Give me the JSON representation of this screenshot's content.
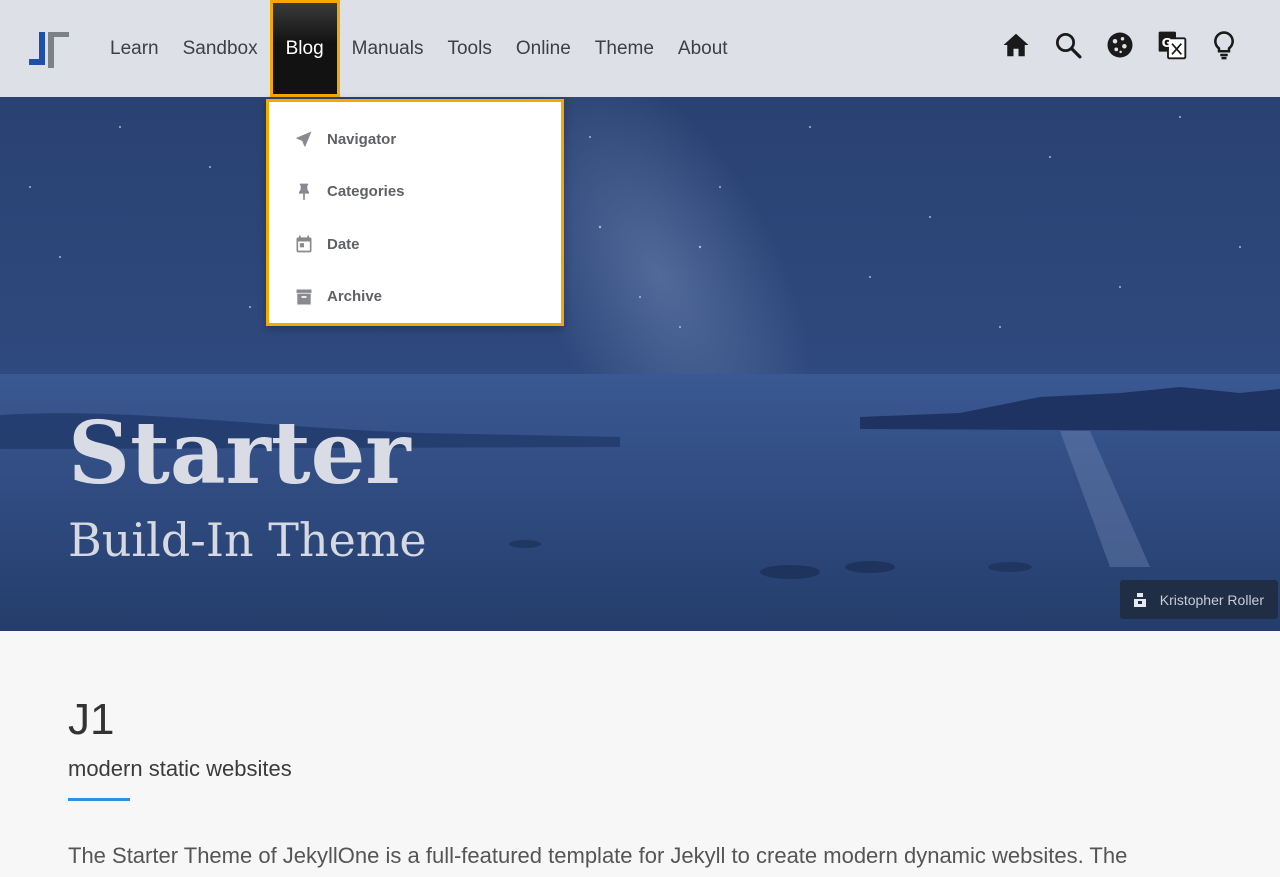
{
  "nav": {
    "items": [
      {
        "label": "Learn"
      },
      {
        "label": "Sandbox"
      },
      {
        "label": "Blog"
      },
      {
        "label": "Manuals"
      },
      {
        "label": "Tools"
      },
      {
        "label": "Online"
      },
      {
        "label": "Theme"
      },
      {
        "label": "About"
      }
    ],
    "active": "Blog",
    "icons": [
      "home-icon",
      "search-icon",
      "cookie-icon",
      "translate-icon",
      "lightbulb-icon"
    ]
  },
  "dropdown": {
    "items": [
      {
        "label": "Navigator",
        "icon": "navigation-arrow-icon"
      },
      {
        "label": "Categories",
        "icon": "pin-icon"
      },
      {
        "label": "Date",
        "icon": "calendar-icon"
      },
      {
        "label": "Archive",
        "icon": "archive-icon"
      }
    ]
  },
  "hero": {
    "title": "Starter",
    "subtitle": "Build-In Theme",
    "credit": "Kristopher Roller"
  },
  "content": {
    "title": "J1",
    "subtitle": "modern static websites",
    "body": "The Starter Theme of JekyllOne is a full-featured template for Jekyll to create modern dynamic websites. The"
  },
  "colors": {
    "accent": "#f2a900",
    "hero_blue": "#2b4576",
    "nav_bg": "#dde0e6",
    "link_blue": "#2f8fe0"
  }
}
